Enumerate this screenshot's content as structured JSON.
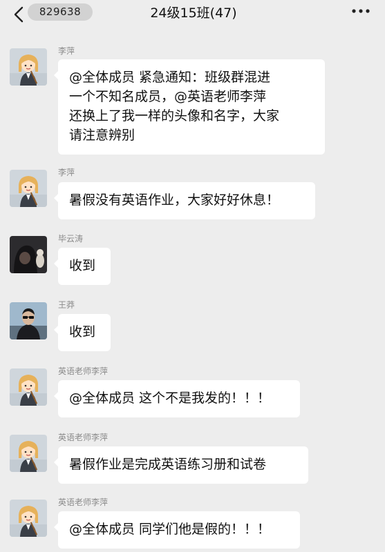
{
  "header": {
    "badge": "829638",
    "title": "24级15班(47)"
  },
  "messages": [
    {
      "sender": "李萍",
      "lines": [
        "@全体成员 紧急通知：班级群混进",
        "一个不知名成员，@英语老师李萍",
        "还换上了我一样的头像和名字，大家",
        "请注意辨别"
      ]
    },
    {
      "sender": "李萍",
      "lines": [
        "暑假没有英语作业，大家好好休息！"
      ]
    },
    {
      "sender": "毕云涛",
      "lines": [
        "收到"
      ]
    },
    {
      "sender": "王莽",
      "lines": [
        "收到"
      ]
    },
    {
      "sender": "英语老师李萍",
      "lines": [
        "@全体成员 这个不是我发的！！！"
      ]
    },
    {
      "sender": "英语老师李萍",
      "lines": [
        "暑假作业是完成英语练习册和试卷"
      ]
    },
    {
      "sender": "英语老师李萍",
      "lines": [
        "@全体成员 同学们他是假的！！！"
      ]
    }
  ]
}
